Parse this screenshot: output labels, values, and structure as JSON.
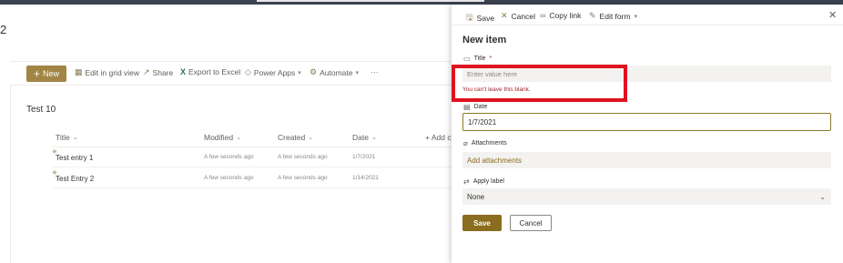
{
  "site": {
    "number": "2"
  },
  "commandbar": {
    "new_label": "New",
    "edit_grid_label": "Edit in grid view",
    "share_label": "Share",
    "export_label": "Export to Excel",
    "power_apps_label": "Power Apps",
    "automate_label": "Automate",
    "more_label": "···"
  },
  "list": {
    "title": "Test 10",
    "columns": {
      "title": "Title",
      "modified": "Modified",
      "created": "Created",
      "date": "Date",
      "add_column": "+ Add c"
    },
    "rows": [
      {
        "title": "Test entry 1",
        "modified": "A few seconds ago",
        "created": "A few seconds ago",
        "date": "1/7/2021"
      },
      {
        "title": "Test Entry 2",
        "modified": "A few seconds ago",
        "created": "A few seconds ago",
        "date": "1/14/2021"
      }
    ]
  },
  "panel": {
    "toolbar": {
      "save": "Save",
      "cancel": "Cancel",
      "copy_link": "Copy link",
      "edit_form": "Edit form"
    },
    "heading": "New item",
    "fields": {
      "title_label": "Title",
      "required_mark": "*",
      "title_placeholder": "Enter value here",
      "title_error": "You can't leave this blank.",
      "date_label": "Date",
      "date_value": "1/7/2021",
      "attachments_label": "Attachments",
      "add_attachments": "Add attachments",
      "apply_label_label": "Apply label",
      "apply_label_value": "None"
    },
    "save_button": "Save",
    "cancel_button": "Cancel"
  },
  "icons": {
    "save": "save-icon",
    "cancel": "close-icon",
    "copy_link": "link-icon",
    "edit_form": "pencil-icon",
    "close": "close-icon",
    "title": "text-field-icon",
    "date": "calendar-icon",
    "attachments": "paperclip-icon",
    "label": "tag-icon"
  },
  "colors": {
    "accent": "#8a6d1f",
    "new_button": "#a08545",
    "error": "#a4262c",
    "highlight": "#e0121f",
    "topbar": "#3a4250"
  }
}
